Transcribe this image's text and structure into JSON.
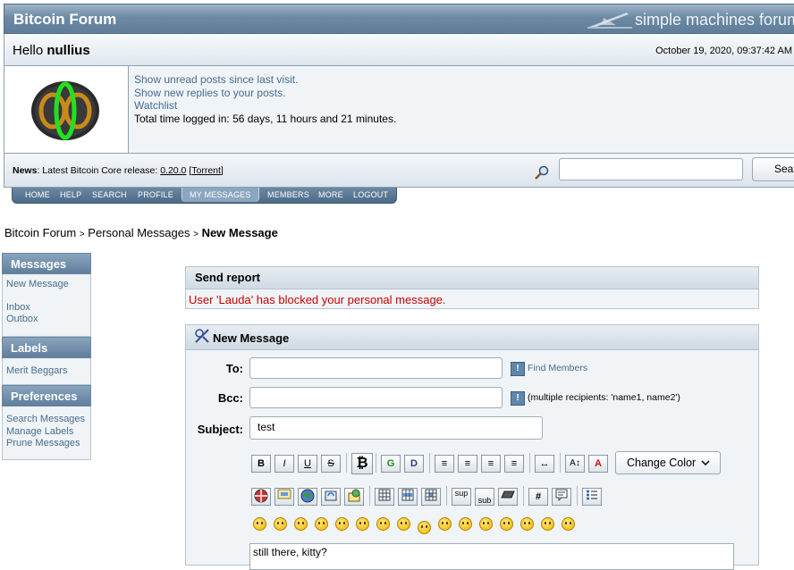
{
  "header": {
    "forum_title": "Bitcoin Forum",
    "brand": "simple machines forum"
  },
  "hello": {
    "greeting": "Hello",
    "username": "nullius",
    "datetime": "October 19, 2020, 09:37:42 AM"
  },
  "user_links": {
    "unread": "Show unread posts since last visit.",
    "replies": "Show new replies to your posts.",
    "watchlist": "Watchlist",
    "logged_in": "Total time logged in: 56 days, 11 hours and 21 minutes."
  },
  "news": {
    "label": "News",
    "text": ": Latest Bitcoin Core release: ",
    "version": "0.20.0",
    "torrent_open": " [",
    "torrent": "Torrent",
    "torrent_close": "]"
  },
  "search": {
    "button": "Sear"
  },
  "menu": [
    "HOME",
    "HELP",
    "SEARCH",
    "PROFILE",
    "MY MESSAGES",
    "MEMBERS",
    "MORE",
    "LOGOUT"
  ],
  "breadcrumb": {
    "items": [
      "Bitcoin Forum",
      "Personal Messages",
      "New Message"
    ],
    "separator": ">"
  },
  "sidebar": {
    "messages": {
      "title": "Messages",
      "items": [
        "New Message",
        "Inbox",
        "Outbox"
      ]
    },
    "labels": {
      "title": "Labels",
      "items": [
        "Merit Beggars"
      ]
    },
    "preferences": {
      "title": "Preferences",
      "items": [
        "Search Messages",
        "Manage Labels",
        "Prune Messages"
      ]
    }
  },
  "report": {
    "title": "Send report",
    "message": "User 'Lauda' has blocked your personal message."
  },
  "compose": {
    "title": "New Message",
    "to_label": "To:",
    "bcc_label": "Bcc:",
    "subject_label": "Subject:",
    "subject_value": "test",
    "find_members": "Find Members",
    "bcc_help": "(multiple recipients: 'name1, name2')",
    "color_select": "Change Color",
    "body": "still there, kitty?",
    "toolbar1": [
      "B",
      "I",
      "U",
      "S",
      "₿",
      "G",
      "D",
      "≡",
      "≡",
      "≡",
      "≡",
      "↔",
      "A↕",
      "A"
    ],
    "toolbar2": [
      "flash",
      "img",
      "url",
      "ftp",
      "email",
      "table",
      "tr",
      "td",
      "sup",
      "sub",
      "tt",
      "#",
      "quote",
      "list"
    ],
    "smiley_count": 16
  }
}
